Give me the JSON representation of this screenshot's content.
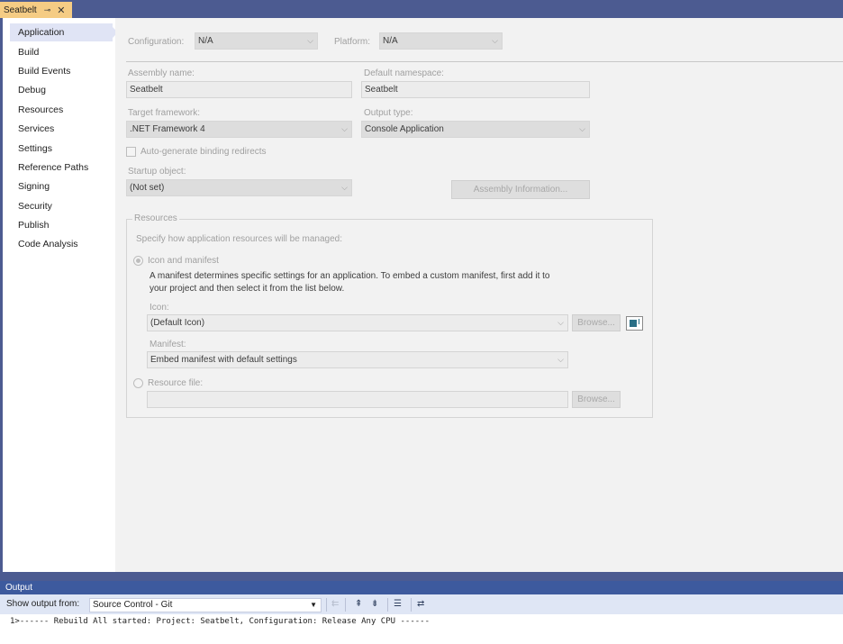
{
  "tab": {
    "title": "Seatbelt",
    "pin_glyph": "⊸",
    "close_glyph": "✕"
  },
  "nav": {
    "items": [
      {
        "label": "Application"
      },
      {
        "label": "Build"
      },
      {
        "label": "Build Events"
      },
      {
        "label": "Debug"
      },
      {
        "label": "Resources"
      },
      {
        "label": "Services"
      },
      {
        "label": "Settings"
      },
      {
        "label": "Reference Paths"
      },
      {
        "label": "Signing"
      },
      {
        "label": "Security"
      },
      {
        "label": "Publish"
      },
      {
        "label": "Code Analysis"
      }
    ],
    "active": "Application"
  },
  "config": {
    "configuration_label": "Configuration:",
    "configuration_value": "N/A",
    "platform_label": "Platform:",
    "platform_value": "N/A"
  },
  "app": {
    "assembly_name_label": "Assembly name:",
    "assembly_name_value": "Seatbelt",
    "default_namespace_label": "Default namespace:",
    "default_namespace_value": "Seatbelt",
    "target_framework_label": "Target framework:",
    "target_framework_value": ".NET Framework 4",
    "output_type_label": "Output type:",
    "output_type_value": "Console Application",
    "auto_binding_label": "Auto-generate binding redirects",
    "startup_object_label": "Startup object:",
    "startup_object_value": "(Not set)",
    "assembly_info_button": "Assembly Information..."
  },
  "resources": {
    "group_title": "Resources",
    "description": "Specify how application resources will be managed:",
    "icon_manifest_label": "Icon and manifest",
    "manifest_desc_line1": "A manifest determines specific settings for an application. To embed a custom manifest, first add it to",
    "manifest_desc_line2": "your project and then select it from the list below.",
    "icon_label": "Icon:",
    "icon_value": "(Default Icon)",
    "browse_label": "Browse...",
    "manifest_label": "Manifest:",
    "manifest_value": "Embed manifest with default settings",
    "resource_file_label": "Resource file:",
    "resource_file_value": "",
    "browse2_label": "Browse..."
  },
  "output": {
    "title": "Output",
    "show_from_label": "Show output from:",
    "source_value": "Source Control - Git",
    "line": "1>------ Rebuild All started: Project: Seatbelt, Configuration: Release Any CPU ------"
  },
  "colors": {
    "accent": "#4c5b91",
    "tab_active": "#f5cc84",
    "output_header": "#3d5a9e"
  }
}
